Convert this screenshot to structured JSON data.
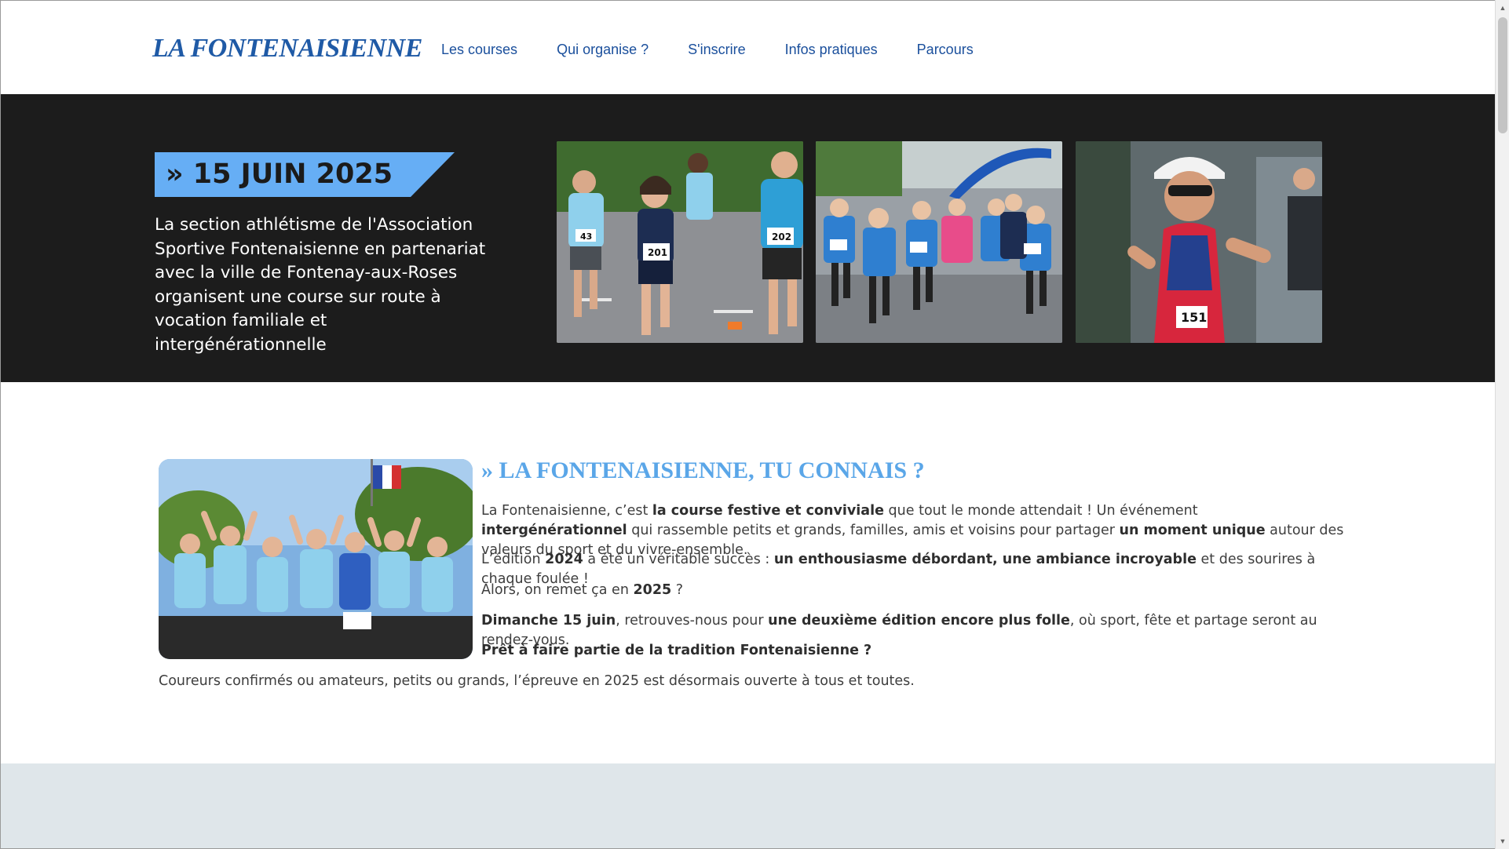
{
  "header": {
    "logo": "LA FONTENAISIENNE",
    "nav": [
      {
        "label": "Les courses"
      },
      {
        "label": "Qui organise ?"
      },
      {
        "label": "S'inscrire"
      },
      {
        "label": "Infos pratiques"
      },
      {
        "label": "Parcours"
      }
    ]
  },
  "hero": {
    "date": "» 15 JUIN 2025",
    "description": "La section athlétisme de l'Association Sportive Fontenaisienne en partenariat avec la ville de Fontenay-aux-Roses organisent une course sur route à vocation familiale et intergénérationnelle",
    "bib_numbers": [
      "43",
      "201",
      "202",
      "151"
    ]
  },
  "intro": {
    "title": "» LA FONTENAISIENNE, TU CONNAIS ?",
    "p1": {
      "a": "La Fontenaisienne, c’est ",
      "b": "la course festive et conviviale",
      "c": " que tout le monde attendait ! Un événement ",
      "d": "intergénérationnel",
      "e": " qui rassemble petits et grands, familles, amis et voisins pour partager ",
      "f": "un moment unique",
      "g": " autour des valeurs du sport et du vivre-ensemble."
    },
    "p2": {
      "a": "L’édition ",
      "b": "2024",
      "c": " a été un véritable succès : ",
      "d": "un enthousiasme débordant, une ambiance incroyable",
      "e": " et des sourires à chaque foulée !"
    },
    "p3": {
      "a": "Alors, on remet ça en ",
      "b": "2025",
      "c": " ?"
    },
    "p4": {
      "a": "Dimanche 15 juin",
      "b": ", retrouves-nous pour ",
      "c": "une deuxième édition encore plus folle",
      "d": ", où sport, fête et partage seront au rendez-vous."
    },
    "p5": "Prêt à faire partie de la tradition Fontenaisienne ?",
    "p6": "Coureurs confirmés ou amateurs, petits ou grands, l’épreuve en 2025 est désormais ouverte à tous et toutes."
  },
  "colors": {
    "brand_blue": "#1f5aa6",
    "accent_light_blue": "#5aa6e8",
    "hero_bg": "#1c1c1c",
    "banner_blue": "#66aef5"
  }
}
